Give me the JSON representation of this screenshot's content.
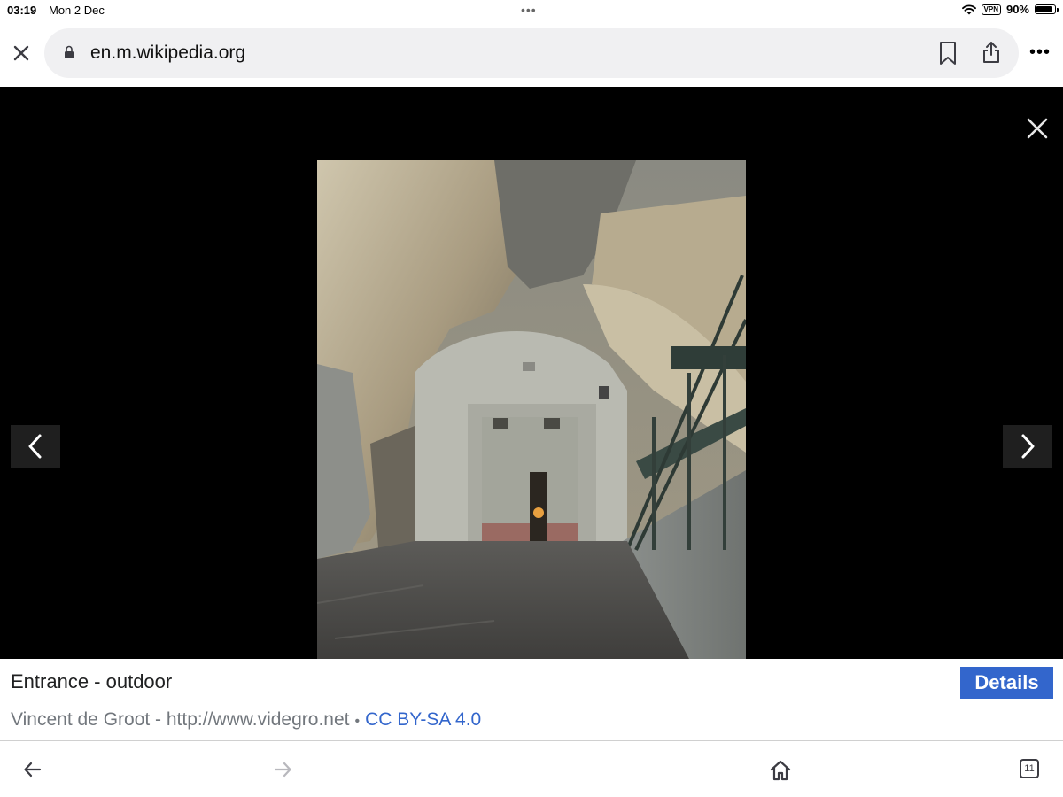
{
  "status_bar": {
    "time": "03:19",
    "date": "Mon 2 Dec",
    "vpn": "VPN",
    "battery": "90%",
    "battery_level": 0.9
  },
  "browser": {
    "url": "en.m.wikipedia.org",
    "more": "•••"
  },
  "viewer": {
    "caption_title": "Entrance - outdoor",
    "details_label": "Details",
    "author": "Vincent de Groot - http://www.videgro.net",
    "separator": "•",
    "license": "CC BY-SA 4.0"
  },
  "toolbar": {
    "tabs_count": "11"
  },
  "icons": [
    "close-icon",
    "lock-icon",
    "bookmark-icon",
    "share-icon",
    "more-icon",
    "chevron-left-icon",
    "chevron-right-icon",
    "back-arrow-icon",
    "forward-arrow-icon",
    "home-icon",
    "tabs-icon",
    "wifi-icon",
    "battery-icon"
  ]
}
